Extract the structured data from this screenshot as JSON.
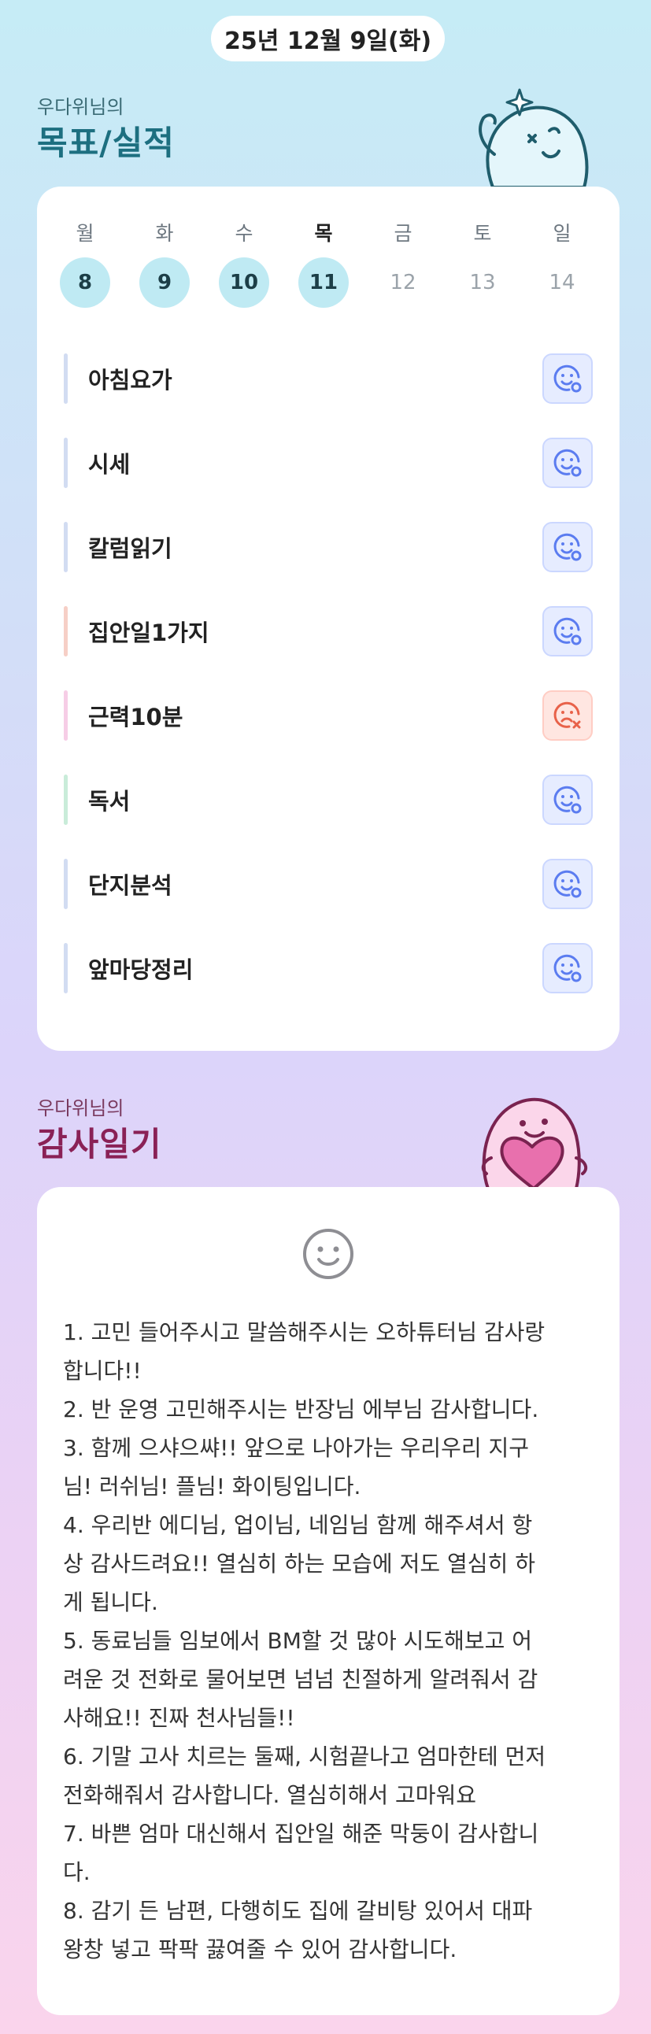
{
  "header": {
    "date": "25년 12월 9일(화)"
  },
  "goals_section": {
    "subtitle": "우다위님의",
    "title": "목표/실적"
  },
  "week": {
    "days": [
      {
        "name": "월",
        "num": "8",
        "state": "done"
      },
      {
        "name": "화",
        "num": "9",
        "state": "done"
      },
      {
        "name": "수",
        "num": "10",
        "state": "done"
      },
      {
        "name": "목",
        "num": "11",
        "state": "done",
        "today": true
      },
      {
        "name": "금",
        "num": "12",
        "state": "future"
      },
      {
        "name": "토",
        "num": "13",
        "state": "future"
      },
      {
        "name": "일",
        "num": "14",
        "state": "future"
      }
    ]
  },
  "goals": [
    {
      "label": "아침요가",
      "bar_color": "#d2dcf2",
      "status": "done"
    },
    {
      "label": "시세",
      "bar_color": "#d2dcf2",
      "status": "done"
    },
    {
      "label": "칼럼읽기",
      "bar_color": "#d2dcf2",
      "status": "done"
    },
    {
      "label": "집안일1가지",
      "bar_color": "#f6cfc6",
      "status": "done"
    },
    {
      "label": "근력10분",
      "bar_color": "#f6cde6",
      "status": "fail"
    },
    {
      "label": "독서",
      "bar_color": "#c9ecd9",
      "status": "done"
    },
    {
      "label": "단지분석",
      "bar_color": "#d2dcf2",
      "status": "done"
    },
    {
      "label": "앞마당정리",
      "bar_color": "#d2dcf2",
      "status": "done"
    }
  ],
  "gratitude_section": {
    "subtitle": "우다위님의",
    "title": "감사일기"
  },
  "gratitude": {
    "text": "1. 고민 들어주시고 말씀해주시는 오하튜터님 감사랑\n합니다!!\n2. 반 운영 고민해주시는 반장님 에부님 감사합니다.\n3. 함께 으샤으쌰!! 앞으로 나아가는 우리우리 지구\n님! 러쉬님! 플님! 화이팅입니다.\n4. 우리반 에디님, 업이님, 네임님 함께 해주셔서 항\n상 감사드려요!! 열심히 하는 모습에 저도 열심히 하\n게 됩니다.\n5. 동료님들 임보에서 BM할 것 많아 시도해보고 어\n려운 것 전화로 물어보면 넘넘 친절하게 알려줘서 감\n사해요!! 진짜 천사님들!!\n6. 기말 고사 치르는 둘째, 시험끝나고 엄마한테 먼저\n전화해줘서 감사합니다. 열심히해서 고마워요\n7. 바쁜 엄마 대신해서 집안일 해준 막둥이 감사합니\n다.\n8. 감기 든 남편, 다행히도 집에 갈비탕 있어서 대파\n왕창 넣고 팍팍 끓여줄 수 있어 감사합니다."
  },
  "colors": {
    "accent_teal": "#1d6f80",
    "accent_pink": "#8a2156",
    "status_done": "#5b7cf0",
    "status_fail": "#e8624a"
  }
}
